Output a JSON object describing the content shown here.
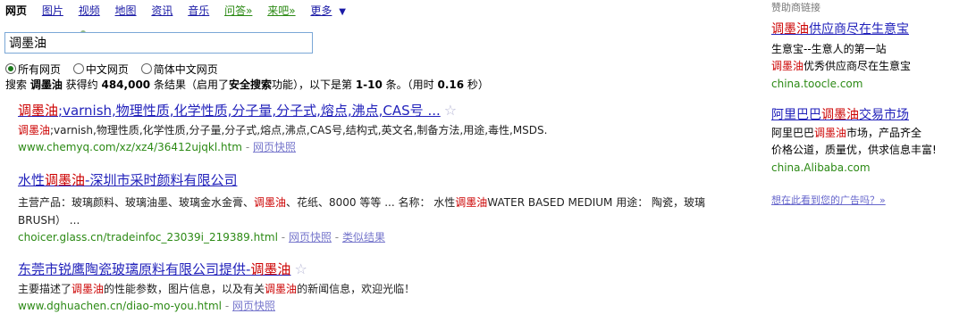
{
  "nav": {
    "items": [
      {
        "label": "网页",
        "active": true
      },
      {
        "label": "图片"
      },
      {
        "label": "视频"
      },
      {
        "label": "地图"
      },
      {
        "label": "资讯"
      },
      {
        "label": "音乐"
      },
      {
        "label": "问答»",
        "green": true
      },
      {
        "label": "来吧»",
        "green": true
      },
      {
        "label": "更多"
      }
    ],
    "more_arrow": "▼"
  },
  "search": {
    "value": "调墨油"
  },
  "radios": [
    {
      "label": "所有网页",
      "checked": true
    },
    {
      "label": "中文网页",
      "checked": false
    },
    {
      "label": "简体中文网页",
      "checked": false
    }
  ],
  "stats": {
    "p1": "搜索 ",
    "query": "调墨油",
    "p2": " 获得约 ",
    "count": "484,000",
    "p3": " 条结果（启用了",
    "safe": "安全搜索",
    "p4": "功能），以下是第 ",
    "range": "1-10",
    "p5": " 条。（用时 ",
    "time": "0.16",
    "p6": " 秒）"
  },
  "results": [
    {
      "title_hl": "调墨油",
      "title_rest": ";varnish,物理性质,化学性质,分子量,分子式,熔点,沸点,CAS号 ...",
      "snippet_hl": "调墨油",
      "snippet_rest": ";varnish,物理性质,化学性质,分子量,分子式,熔点,沸点,CAS号,结构式,英文名,制备方法,用途,毒性,MSDS.",
      "url": "www.chemyq.com/xz/xz4/36412ujqkl.htm",
      "links": [
        "网页快照"
      ]
    },
    {
      "title_pre": "水性",
      "title_hl": "调墨油",
      "title_rest": "-深圳市采时颜料有限公司",
      "snippet_line1_a": "主营产品：玻璃颜料、玻璃油墨、玻璃金水金膏、",
      "snippet_line1_hl": "调墨油",
      "snippet_line1_b": "、花纸、8000 等等 ... 名称：  水性",
      "snippet_line1_hl2": "调墨油",
      "snippet_line1_c": "WATER BASED MEDIUM 用途：  陶瓷，玻璃",
      "snippet_line2": "BRUSH） ...",
      "url": "choicer.glass.cn/tradeinfoc_23039i_219389.html",
      "links": [
        "网页快照",
        "类似结果"
      ]
    },
    {
      "title_pre": "东莞市锐鹰陶瓷玻璃原料有限公司提供-",
      "title_hl": "调墨油",
      "snippet_a": "主要描述了",
      "snippet_hl": "调墨油",
      "snippet_b": "的性能参数，图片信息，以及有关",
      "snippet_hl2": "调墨油",
      "snippet_c": "的新闻信息，欢迎光临！",
      "url": "www.dghuachen.cn/diao-mo-you.html",
      "links": [
        "网页快照"
      ]
    }
  ],
  "ads": {
    "heading": "赞助商链接",
    "items": [
      {
        "title_hl": "调墨油",
        "title_rest": "供应商尽在生意宝",
        "desc1": "生意宝--生意人的第一站",
        "desc2_hl": "调墨油",
        "desc2_rest": "优秀供应商尽在生意宝",
        "url": "china.toocle.com"
      },
      {
        "title_pre": "阿里巴巴",
        "title_hl": "调墨油",
        "title_rest": "交易市场",
        "desc1_pre": "阿里巴巴",
        "desc1_hl": "调墨油",
        "desc1_rest": "市场，产品齐全",
        "desc2": "价格公道，质量优，供求信息丰富!",
        "url": "china.Alibaba.com"
      }
    ],
    "more": "想在此看到您的广告吗？»"
  }
}
